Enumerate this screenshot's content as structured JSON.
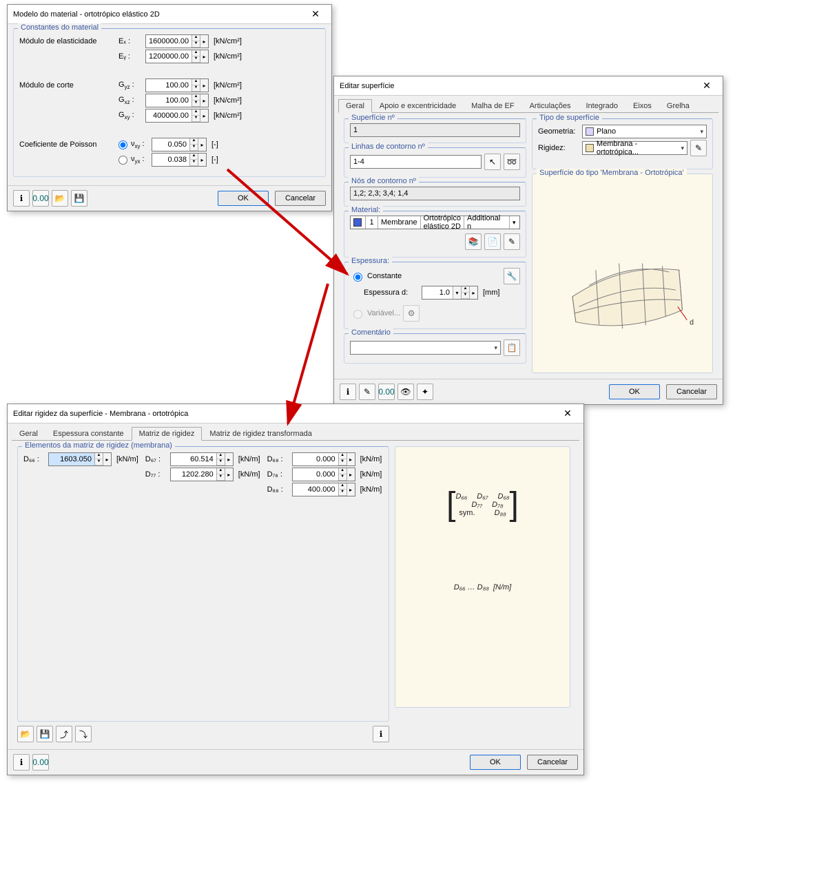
{
  "d1": {
    "title": "Modelo do material - ortotrópico elástico 2D",
    "section_constants": "Constantes do material",
    "lbl_modulo_elast": "Módulo de elasticidade",
    "Ex_sym": "Eₓ :",
    "Ex_val": "1600000.00",
    "Ey_sym": "Eᵧ :",
    "Ey_val": "1200000.00",
    "lbl_modulo_corte": "Módulo de corte",
    "Gyz_sym": "Gyz :",
    "Gyz_val": "100.00",
    "Gxz_sym": "Gxz :",
    "Gxz_val": "100.00",
    "Gxy_sym": "Gxy :",
    "Gxy_val": "400000.00",
    "lbl_poisson": "Coeficiente de Poisson",
    "vxy_sym": "νxy :",
    "vxy_val": "0.050",
    "vyx_sym": "νyx :",
    "vyx_val": "0.038",
    "unit_kncm2": "[kN/cm²]",
    "unit_dash": "[-]",
    "ok": "OK",
    "cancel": "Cancelar"
  },
  "d2": {
    "title": "Editar superfície",
    "tabs": [
      "Geral",
      "Apoio e excentricidade",
      "Malha de EF",
      "Articulações",
      "Integrado",
      "Eixos",
      "Grelha"
    ],
    "grp_surface_no": "Superfície nº",
    "surface_no_val": "1",
    "grp_contour_lines": "Linhas de contorno nº",
    "contour_lines_val": "1-4",
    "grp_contour_nodes": "Nós de contorno nº",
    "contour_nodes_val": "1,2; 2,3; 3,4; 1,4",
    "grp_material": "Material:",
    "mat_num": "1",
    "mat_name": "Membrane",
    "mat_model": "Ortotrópico elástico 2D",
    "mat_extra": "Additional n",
    "grp_thickness": "Espessura:",
    "thk_constant": "Constante",
    "thk_d_label": "Espessura d:",
    "thk_d_val": "1.0",
    "thk_d_unit": "[mm]",
    "thk_variable": "Variável...",
    "grp_comment": "Comentário",
    "grp_type": "Tipo de superfície",
    "geom_label": "Geometria:",
    "geom_val": "Plano",
    "rigid_label": "Rigidez:",
    "rigid_val": "Membrana - ortotrópica...",
    "preview_title": "Superfície do tipo 'Membrana - Ortotrópica'",
    "ok": "OK",
    "cancel": "Cancelar"
  },
  "d3": {
    "title": "Editar rigidez da superfície - Membrana - ortotrópica",
    "tabs": [
      "Geral",
      "Espessura constante",
      "Matriz de rigidez",
      "Matriz de rigidez transformada"
    ],
    "grp_elem": "Elementos da matriz de rigidez (membrana)",
    "D66_sym": "D₆₆ :",
    "D66_val": "1603.050",
    "D67_sym": "D₆₇ :",
    "D67_val": "60.514",
    "D68_sym": "D₆₈ :",
    "D68_val": "0.000",
    "D77_sym": "D₇₇ :",
    "D77_val": "1202.280",
    "D78_sym": "D₇₈ :",
    "D78_val": "0.000",
    "D88_sym": "D₈₈ :",
    "D88_val": "400.000",
    "unit_knm": "[kN/m]",
    "matrix_D66": "D₆₆",
    "matrix_D67": "D₆₇",
    "matrix_D68": "D₆₈",
    "matrix_D77": "D₇₇",
    "matrix_D78": "D₇₈",
    "matrix_D88": "D₈₈",
    "matrix_sym": "sym.",
    "preview_range": "D₆₆ … D₈₈",
    "preview_unit": "[N/m]",
    "ok": "OK",
    "cancel": "Cancelar"
  }
}
